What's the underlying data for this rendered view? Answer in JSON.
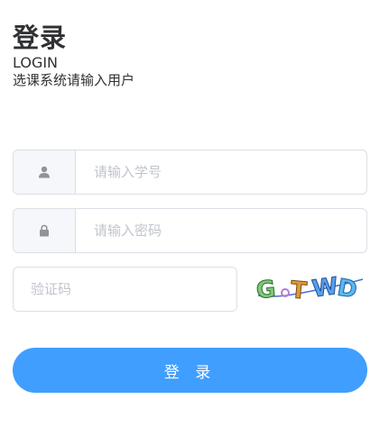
{
  "header": {
    "title": "登录",
    "subtitle": "LOGIN",
    "hint": "选课系统请输入用户"
  },
  "form": {
    "student_id": {
      "placeholder": "请输入学号",
      "value": "",
      "icon": "user-icon"
    },
    "password": {
      "placeholder": "请输入密码",
      "value": "",
      "icon": "lock-icon"
    },
    "captcha": {
      "placeholder": "验证码",
      "value": "",
      "image_text": "GTWD"
    }
  },
  "submit": {
    "label": "登 录",
    "color": "#409eff"
  },
  "colors": {
    "border": "#dcdfe6",
    "prepend_bg": "#f5f7fa",
    "placeholder": "#c0c4cc",
    "icon": "#909399"
  }
}
